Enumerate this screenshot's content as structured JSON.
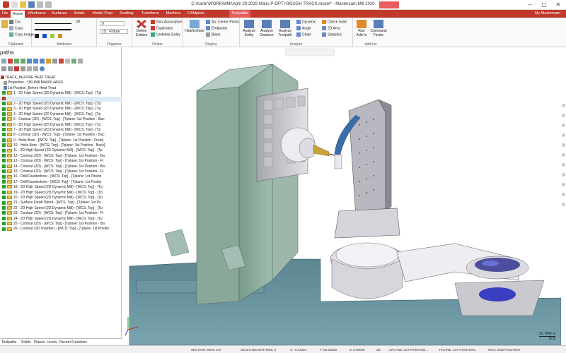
{
  "window": {
    "title": "C:\\Karlin\\WORK\\MMI\\April 29 2019 Mario P-OPTI-ROUGH TRACK.mcam* - Mastercam Mill 2020",
    "context_tag": "..."
  },
  "tabs": [
    {
      "label": "File"
    },
    {
      "label": "Home"
    },
    {
      "label": "Wireframe"
    },
    {
      "label": "Surfaces"
    },
    {
      "label": "Solids"
    },
    {
      "label": "Model Prep"
    },
    {
      "label": "Drafting"
    },
    {
      "label": "Transform"
    },
    {
      "label": "Machine"
    },
    {
      "label": "CAMplete"
    },
    {
      "label": "Toolpaths"
    }
  ],
  "user": "My Mastercam",
  "ribbon": {
    "clipboard": {
      "label": "Clipboard",
      "cut": "Cut",
      "copy": "Copy",
      "copy_image": "Copy Image"
    },
    "attributes": {
      "label": "Attributes",
      "dim": "3D"
    },
    "organize": {
      "label": "Organize",
      "level": "0",
      "select": "1S : Fixture"
    },
    "delete": {
      "label": "Delete",
      "delete_entities": "Delete Entities",
      "non_assoc": "Non-Associative",
      "duplicates": "Duplicates",
      "undelete": "Undelete Entity"
    },
    "display": {
      "label": "Display",
      "hide": "Hide/Unhide",
      "arc_center": "Arc Center Points",
      "endpoints": "Endpoints",
      "blank": "Blank"
    },
    "analyze": {
      "label": "Analyze",
      "entity": "Analyze Entity",
      "distance": "Analyze Distance",
      "toolpath": "Analyze Toolpath",
      "dynamic": "Dynamic",
      "angle": "Angle",
      "chain": "Chain",
      "check_solid": "Check Solid",
      "area": "2D Area",
      "statistics": "Statistics"
    },
    "addins": {
      "label": "Add-Ins",
      "run": "Run Add-In",
      "finder": "Command Finder"
    }
  },
  "panel": {
    "title": "paths",
    "root": "TRACK_BEFORE HEAT TREAT",
    "properties": "Properties - OKUMA MA500 4AXIS",
    "group": "1st Position_Before Heat Treat",
    "ops": [
      "1 - 2D High Speed (2D Dynamic Mill) - [WCS: Top] - [Tpl",
      "",
      "2 - 2D High Speed (2D Dynamic Mill) - [WCS: Top] - [Tp",
      "3 - 2D High Speed (2D Dynamic Mill) - [WCS: Top] - [Tp",
      "4 - 2D High Speed (2D Dynamic Mill) - [WCS: Top] - [Tp",
      "5 - Contour (2D) - [WCS: Top] - [Tplane: 1st Position - Bac",
      "6 - 2D High Speed (2D Dynamic Mill) - [WCS: Top] - [Tp",
      "7 - 2D High Speed (2D Dynamic Mill) - [WCS: Top] - [Tp",
      "8 - Contour (2D) - [WCS: Top] - [Tplane: 1st Position - Bac",
      "9 - Helix Bore - [WCS: Top] - [Tplane: 1st Position - Front]",
      "10 - Helix Bore - [WCS: Top] - [Tplane: 1st Position - Back]",
      "11 - 2D High Speed (2D Dynamic Mill) - [WCS: Top] - [Tp",
      "12 - Contour (2D) - [WCS: Top] - [Tplane: 1st Position - Ba",
      "13 - Contour (2D) - [WCS: Top] - [Tplane: 1st Position - Fr",
      "14 - Contour (2D) - [WCS: Top] - [Tplane: 1st Position - Ba",
      "15 - Contour (2D) - [WCS: Top] - [Tplane: 1st Position - Fr",
      "16 - Drill/Counterbore - [WCS: Top] - [Tplane: 1st Positio",
      "17 - Drill/Counterbore - [WCS: Top] - [Tplane: 1st Positio",
      "18 - 2D High Speed (2D Dynamic Mill) - [WCS: Top] - [Tp",
      "19 - 2D High Speed (2D Dynamic Mill) - [WCS: Top] - [Tp",
      "20 - 2D High Speed (2D Dynamic Mill) - [WCS: Top] - [Tp",
      "21 - Surface Finish Blend - [WCS: Top] - [Tplane: 1st Po",
      "22 - 2D High Speed (2D Dynamic Mill) - [WCS: Top] - [Tp",
      "23 - Contour (2D) - [WCS: Top] - [Tplane: 1st Position - Fr",
      "24 - 2D High Speed (2D Dynamic Mill) - [WCS: Top] - [Tp",
      "25 - Contour (2D) - [WCS: Top] - [Tplane: 1st Position - Ba",
      "26 - Contour (3D chamfer) - [WCS: Top] - [Tplane: 1st Positio"
    ]
  },
  "bottom_tabs": [
    "Toolpaths",
    "Solids",
    "Planes",
    "Levels",
    "Recent Functions"
  ],
  "status": {
    "section_view": "SECTION VIEW: ON",
    "selected": "SELECTED ENTITIES: 0",
    "x": "X: -9.42467",
    "y": "Y: 53.23063",
    "z": "Z: 6.60008",
    "dim": "3D",
    "cplane": "CPLANE: 1ST POSITION...",
    "tplane": "TPLANE: 1ST POSITION...",
    "wcs": "WCS: 2ND POSITION"
  },
  "scale": {
    "value": "32.7842 in",
    "unit": "Inch"
  },
  "colors": {
    "accent": "#c0392b",
    "machine_green": "#8aa89a",
    "machine_teal": "#5e8a95",
    "fixture": "#c9c9cf"
  }
}
